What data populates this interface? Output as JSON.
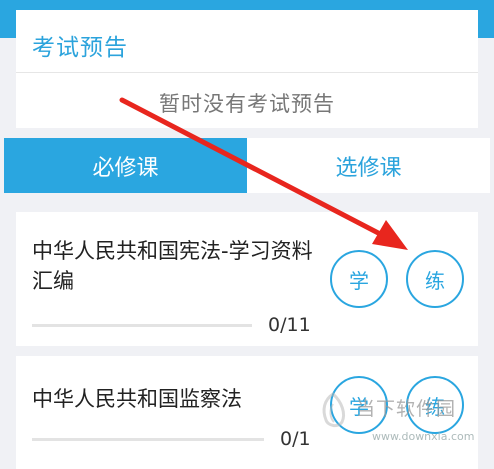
{
  "exam": {
    "title": "考试预告",
    "empty_text": "暂时没有考试预告"
  },
  "tabs": [
    {
      "label": "必修课",
      "active": true
    },
    {
      "label": "选修课",
      "active": false
    }
  ],
  "courses": [
    {
      "title": "中华人民共和国宪法-学习资料汇编",
      "progress": "0/11",
      "learn_label": "学",
      "practice_label": "练"
    },
    {
      "title": "中华人民共和国监察法",
      "progress": "0/1",
      "learn_label": "学",
      "practice_label": "练"
    }
  ],
  "watermark": {
    "text": "当下软件园",
    "url": "www.downxia.com"
  },
  "colors": {
    "accent": "#2aa6e0",
    "arrow": "#e8261e"
  }
}
